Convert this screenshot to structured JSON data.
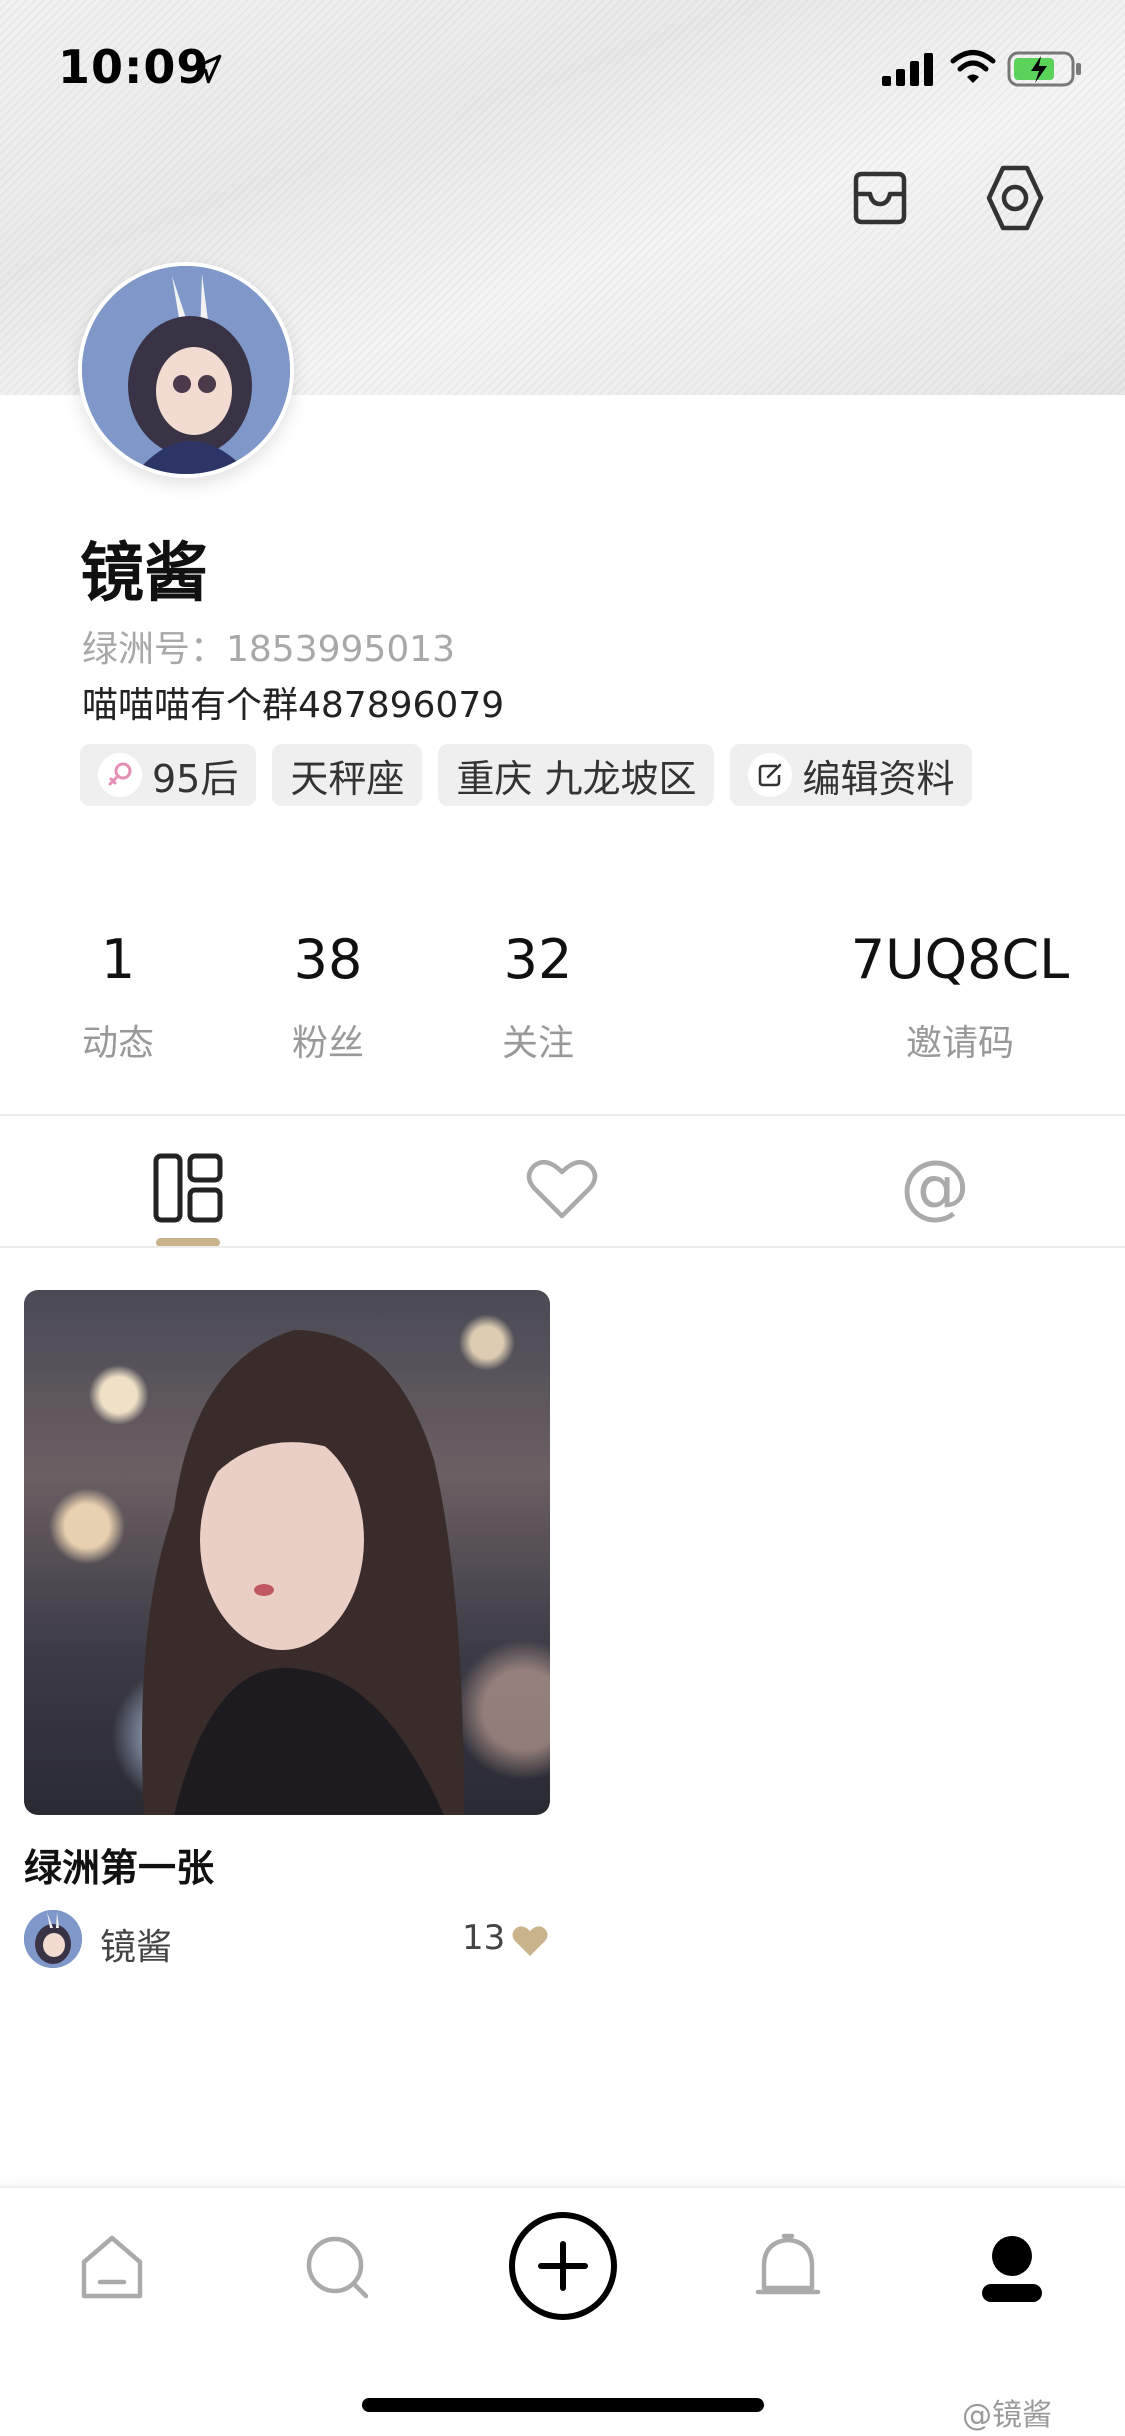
{
  "status_bar": {
    "time": "10:09"
  },
  "profile": {
    "name": "镜酱",
    "oasis_id": "绿洲号：1853995013",
    "bio": "喵喵喵有个群487896079",
    "tags": [
      {
        "label": "95后",
        "icon": "female-gender-icon"
      },
      {
        "label": "天秤座"
      },
      {
        "label": "重庆 九龙坡区"
      },
      {
        "label": "编辑资料",
        "icon": "edit-icon"
      }
    ]
  },
  "stats": {
    "posts": {
      "value": "1",
      "label": "动态"
    },
    "fans": {
      "value": "38",
      "label": "粉丝"
    },
    "following": {
      "value": "32",
      "label": "关注"
    },
    "invite": {
      "value": "7UQ8CL",
      "label": "邀请码"
    }
  },
  "content_tabs": [
    {
      "icon": "grid-icon",
      "active": true
    },
    {
      "icon": "heart-icon",
      "active": false
    },
    {
      "icon": "at-icon",
      "active": false
    }
  ],
  "posts": [
    {
      "title": "绿洲第一张",
      "author": "镜酱",
      "likes": "13"
    }
  ],
  "bottom_nav": [
    {
      "icon": "home-icon"
    },
    {
      "icon": "discover-icon"
    },
    {
      "icon": "add-icon"
    },
    {
      "icon": "bell-icon"
    },
    {
      "icon": "profile-icon",
      "active": true
    }
  ],
  "watermark": "@镜酱",
  "colors": {
    "accent": "#c8b38a",
    "heart": "#c8b38a",
    "female_icon": "#e58fb6",
    "battery": "#5bd35b"
  }
}
